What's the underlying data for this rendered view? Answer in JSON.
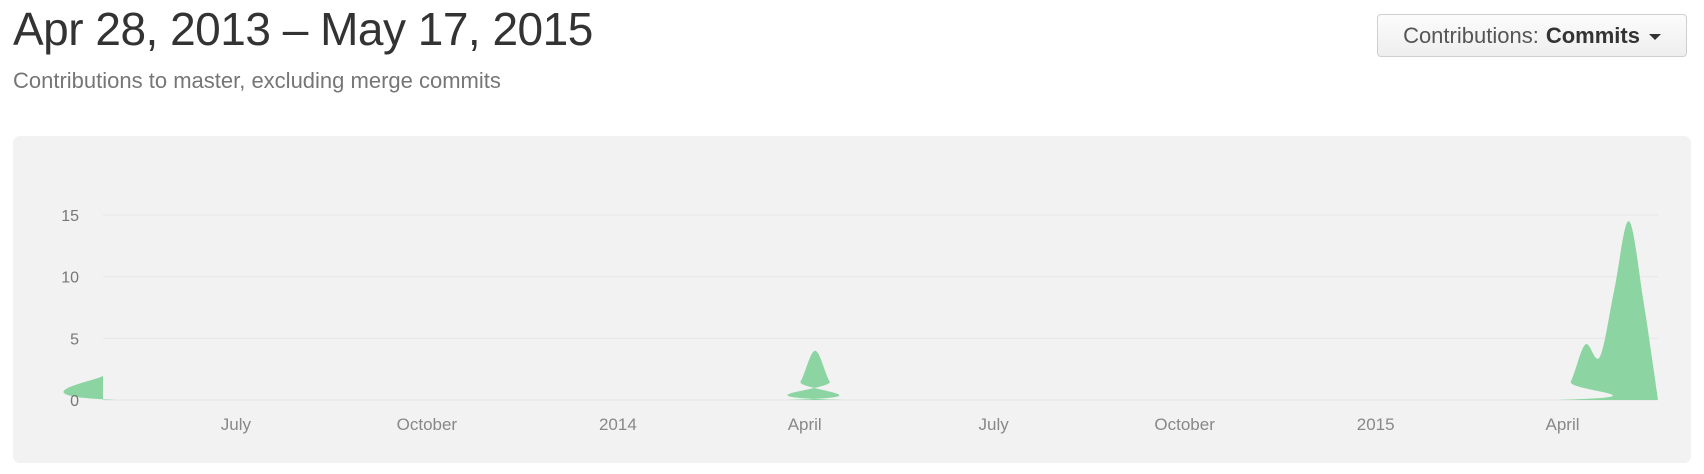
{
  "header": {
    "title": "Apr 28, 2013 – May 17, 2015",
    "subtitle": "Contributions to master, excluding merge commits"
  },
  "dropdown": {
    "label": "Contributions:",
    "value": "Commits"
  },
  "colors": {
    "area": "#8cd5a2",
    "grid": "#e6e6e6",
    "tick_text": "#777777",
    "axis_text": "#888888"
  },
  "chart_data": {
    "type": "area",
    "title": "",
    "xlabel": "",
    "ylabel": "",
    "ylim": [
      0,
      15
    ],
    "y_ticks": [
      0,
      5,
      10,
      15
    ],
    "x_range": [
      "2013-04-28",
      "2015-05-17"
    ],
    "x_tick_labels": [
      {
        "label": "July",
        "date": "2013-07-01"
      },
      {
        "label": "October",
        "date": "2013-10-01"
      },
      {
        "label": "2014",
        "date": "2014-01-01"
      },
      {
        "label": "April",
        "date": "2014-04-01"
      },
      {
        "label": "July",
        "date": "2014-07-01"
      },
      {
        "label": "October",
        "date": "2014-10-01"
      },
      {
        "label": "2015",
        "date": "2015-01-01"
      },
      {
        "label": "April",
        "date": "2015-04-01"
      }
    ],
    "grid": true,
    "series": [
      {
        "values": [
          {
            "x": "2013-04-28",
            "y": 2
          },
          {
            "x": "2013-05-05",
            "y": 0
          },
          {
            "x": "2014-03-23",
            "y": 0
          },
          {
            "x": "2014-03-30",
            "y": 1.5
          },
          {
            "x": "2014-04-06",
            "y": 4
          },
          {
            "x": "2014-04-13",
            "y": 1.5
          },
          {
            "x": "2014-04-20",
            "y": 0
          },
          {
            "x": "2015-03-29",
            "y": 0
          },
          {
            "x": "2015-04-05",
            "y": 1.5
          },
          {
            "x": "2015-04-12",
            "y": 4.5
          },
          {
            "x": "2015-04-19",
            "y": 3.5
          },
          {
            "x": "2015-04-26",
            "y": 9
          },
          {
            "x": "2015-05-03",
            "y": 14.5
          },
          {
            "x": "2015-05-10",
            "y": 8
          },
          {
            "x": "2015-05-17",
            "y": 0
          }
        ]
      }
    ]
  }
}
